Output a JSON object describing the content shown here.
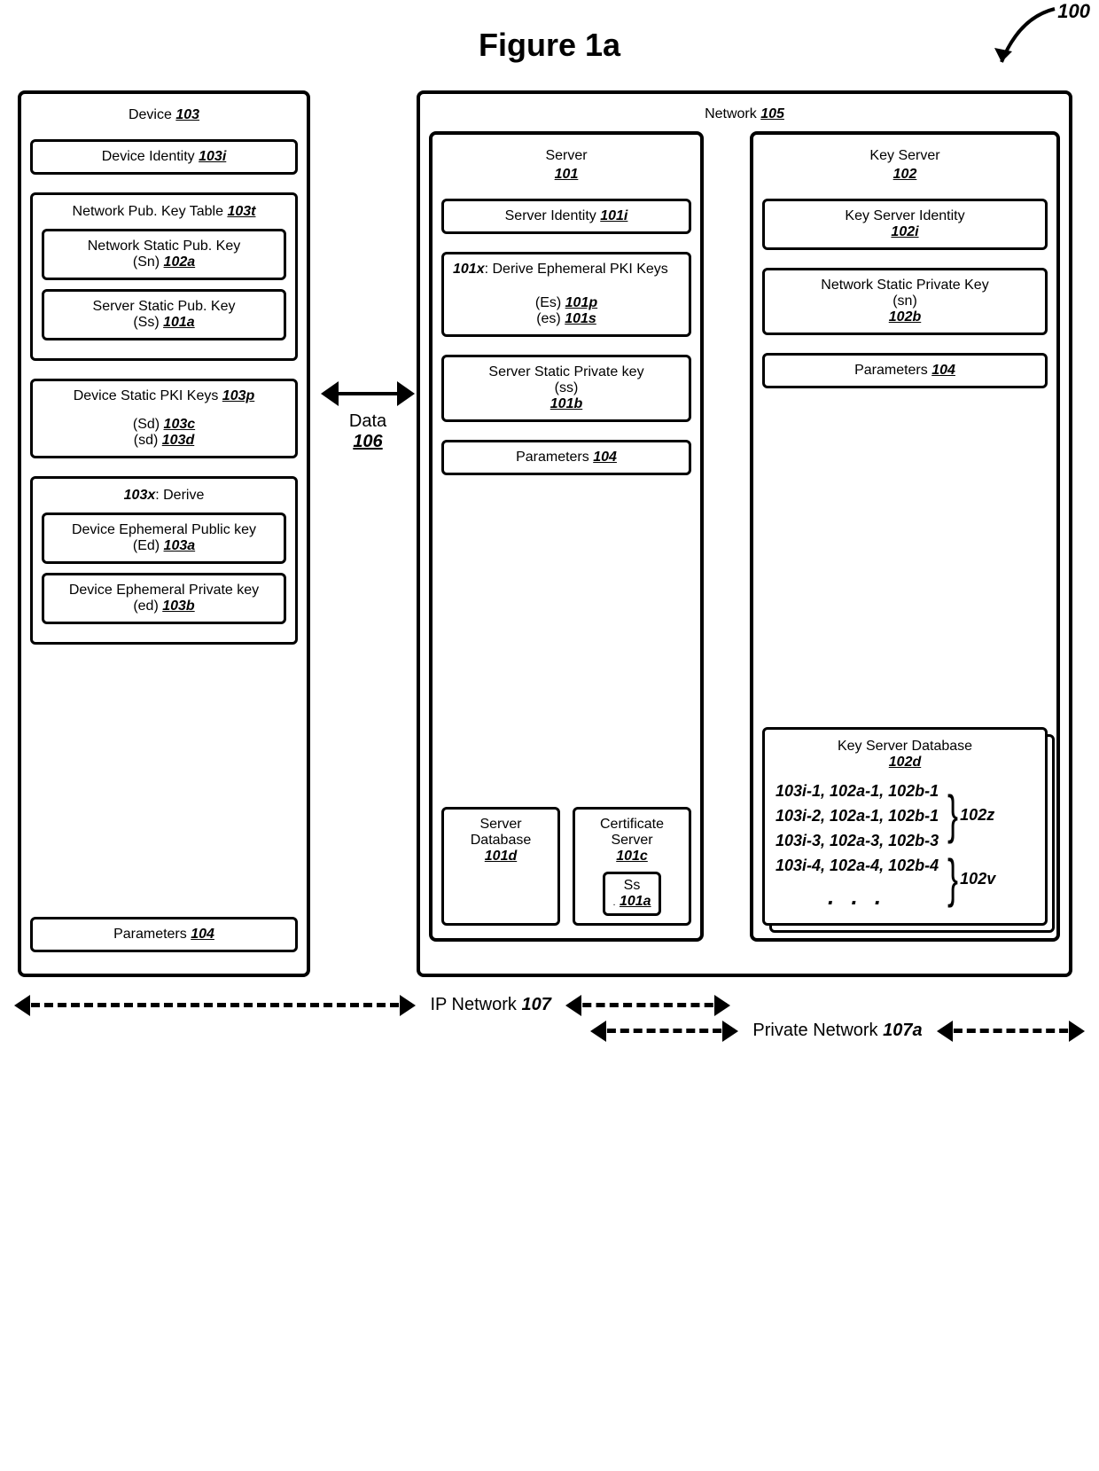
{
  "figure_title": "Figure 1a",
  "system_ref": "100",
  "data_link": {
    "label": "Data",
    "ref": "106"
  },
  "device": {
    "title": "Device",
    "ref": "103",
    "identity": {
      "label": "Device Identity",
      "ref": "103i"
    },
    "pubkey_table": {
      "label": "Network Pub. Key Table",
      "ref": "103t",
      "net_key": {
        "label": "Network Static Pub. Key",
        "sym": "(Sn)",
        "ref": "102a"
      },
      "srv_key": {
        "label": "Server Static Pub. Key",
        "sym": "(Ss)",
        "ref": "101a"
      }
    },
    "static_pki": {
      "label": "Device Static PKI Keys",
      "ref": "103p",
      "Sd": {
        "sym": "(Sd)",
        "ref": "103c"
      },
      "sd": {
        "sym": "(sd)",
        "ref": "103d"
      }
    },
    "derive": {
      "ref": "103x",
      "label": "Derive",
      "pub": {
        "label": "Device Ephemeral Public key",
        "sym": "(Ed)",
        "ref": "103a"
      },
      "priv": {
        "label": "Device Ephemeral Private key",
        "sym": "(ed)",
        "ref": "103b"
      }
    },
    "params": {
      "label": "Parameters",
      "ref": "104"
    }
  },
  "network": {
    "label": "Network",
    "ref": "105",
    "server": {
      "title": "Server",
      "ref": "101",
      "identity": {
        "label": "Server  Identity",
        "ref": "101i"
      },
      "derive": {
        "ref": "101x",
        "label": "Derive Ephemeral PKI Keys",
        "Es": {
          "sym": "(Es)",
          "ref": "101p"
        },
        "es": {
          "sym": "(es)",
          "ref": "101s"
        }
      },
      "static_priv": {
        "label": "Server Static Private key",
        "sym": "(ss)",
        "ref": "101b"
      },
      "params": {
        "label": "Parameters",
        "ref": "104"
      },
      "db": {
        "label": "Server Database",
        "ref": "101d"
      },
      "cert": {
        "label": "Certificate Server",
        "ref": "101c",
        "nested": {
          "label": "Ss",
          "ref": "101a"
        }
      }
    },
    "keyserver": {
      "title": "Key Server",
      "ref": "102",
      "identity": {
        "label": "Key  Server Identity",
        "ref": "102i"
      },
      "static_priv": {
        "label": "Network Static Private Key",
        "sym": "(sn)",
        "ref": "102b"
      },
      "params": {
        "label": "Parameters",
        "ref": "104"
      },
      "db": {
        "label": "Key Server Database",
        "ref": "102d",
        "rows": {
          "r1": "103i-1, 102a-1, 102b-1",
          "r2": "103i-2, 102a-1, 102b-1",
          "r3": "103i-3, 102a-3, 102b-3",
          "r4": "103i-4, 102a-4, 102b-4",
          "ellipsis": ". . ."
        },
        "group1": "102z",
        "group2": "102v"
      }
    }
  },
  "ip_network": {
    "label": "IP Network",
    "ref": "107"
  },
  "private_network": {
    "label": "Private Network",
    "ref": "107a"
  }
}
